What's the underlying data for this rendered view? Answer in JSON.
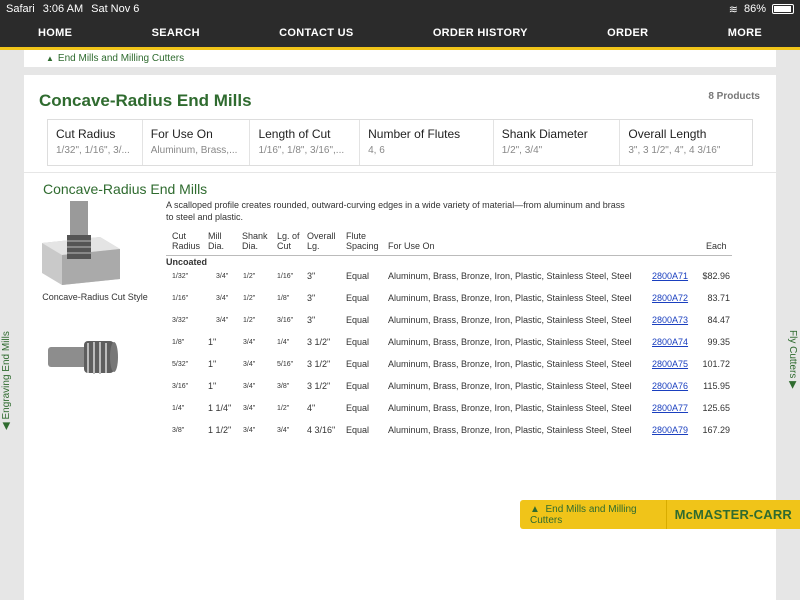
{
  "status": {
    "app": "Safari",
    "time": "3:06 AM",
    "date": "Sat Nov 6",
    "battery": "86%"
  },
  "nav": [
    "HOME",
    "SEARCH",
    "CONTACT US",
    "ORDER HISTORY",
    "ORDER",
    "MORE"
  ],
  "breadcrumb": "End Mills and Milling Cutters",
  "page": {
    "title": "Concave-Radius End Mills",
    "count": "8 Products"
  },
  "filters": [
    {
      "label": "Cut Radius",
      "value": "1/32\", 1/16\", 3/..."
    },
    {
      "label": "For Use On",
      "value": "Aluminum, Brass,..."
    },
    {
      "label": "Length of Cut",
      "value": "1/16\", 1/8\", 3/16\",..."
    },
    {
      "label": "Number of Flutes",
      "value": "4, 6"
    },
    {
      "label": "Shank Diameter",
      "value": "1/2\", 3/4\""
    },
    {
      "label": "Overall Length",
      "value": "3\", 3 1/2\", 4\", 4 3/16\""
    }
  ],
  "section": {
    "title": "Concave-Radius End Mills",
    "description": "A scalloped profile creates rounded, outward-curving edges in a wide variety of material—from aluminum and brass to steel and plastic.",
    "image_caption": "Concave-Radius Cut Style"
  },
  "table": {
    "headers": [
      "Cut Radius",
      "Mill Dia.",
      "Shank Dia.",
      "Lg. of Cut",
      "Overall Lg.",
      "Flute Spacing",
      "For Use On",
      "Each"
    ],
    "group": "Uncoated",
    "rows": [
      [
        "1/32\"",
        "3/4\"",
        "1/2\"",
        "1/16\"",
        "3\"",
        "Equal",
        "Aluminum, Brass, Bronze, Iron, Plastic, Stainless Steel, Steel",
        "2800A71",
        "$82.96"
      ],
      [
        "1/16\"",
        "3/4\"",
        "1/2\"",
        "1/8\"",
        "3\"",
        "Equal",
        "Aluminum, Brass, Bronze, Iron, Plastic, Stainless Steel, Steel",
        "2800A72",
        "83.71"
      ],
      [
        "3/32\"",
        "3/4\"",
        "1/2\"",
        "3/16\"",
        "3\"",
        "Equal",
        "Aluminum, Brass, Bronze, Iron, Plastic, Stainless Steel, Steel",
        "2800A73",
        "84.47"
      ],
      [
        "1/8\"",
        "1\"",
        "3/4\"",
        "1/4\"",
        "3 1/2\"",
        "Equal",
        "Aluminum, Brass, Bronze, Iron, Plastic, Stainless Steel, Steel",
        "2800A74",
        "99.35"
      ],
      [
        "5/32\"",
        "1\"",
        "3/4\"",
        "5/16\"",
        "3 1/2\"",
        "Equal",
        "Aluminum, Brass, Bronze, Iron, Plastic, Stainless Steel, Steel",
        "2800A75",
        "101.72"
      ],
      [
        "3/16\"",
        "1\"",
        "3/4\"",
        "3/8\"",
        "3 1/2\"",
        "Equal",
        "Aluminum, Brass, Bronze, Iron, Plastic, Stainless Steel, Steel",
        "2800A76",
        "115.95"
      ],
      [
        "1/4\"",
        "1 1/4\"",
        "3/4\"",
        "1/2\"",
        "4\"",
        "Equal",
        "Aluminum, Brass, Bronze, Iron, Plastic, Stainless Steel, Steel",
        "2800A77",
        "125.65"
      ],
      [
        "3/8\"",
        "1 1/2\"",
        "3/4\"",
        "3/4\"",
        "4 3/16\"",
        "Equal",
        "Aluminum, Brass, Bronze, Iron, Plastic, Stainless Steel, Steel",
        "2800A79",
        "167.29"
      ]
    ]
  },
  "side_left": "Engraving End Mills",
  "side_right": "Fly Cutters",
  "badge": {
    "link": "End Mills and Milling Cutters",
    "logo": "McMASTER-CARR"
  },
  "colors": {
    "brand_green": "#2f6b2f",
    "brand_yellow": "#f0c419",
    "nav_bg": "#2b2b2b",
    "link_blue": "#1a3fbf"
  }
}
